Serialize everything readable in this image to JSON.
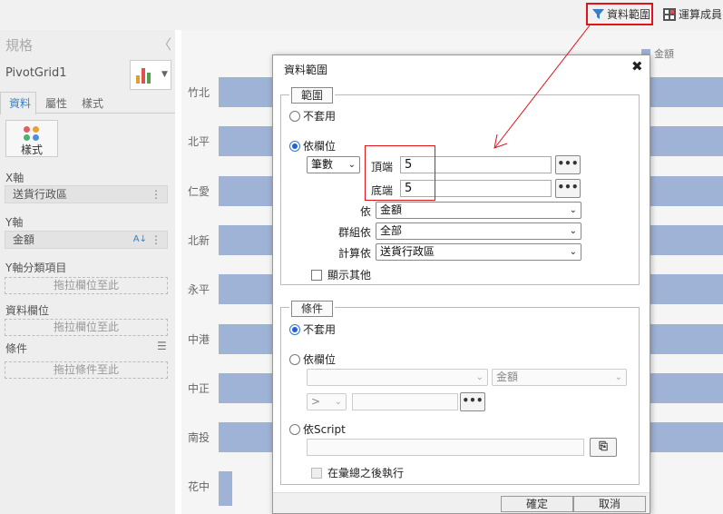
{
  "toolbar": {
    "data_range_label": "資料範圍",
    "calc_member_label": "運算成員"
  },
  "left_panel": {
    "title": "規格",
    "component_name": "PivotGrid1",
    "tabs": [
      "資料",
      "屬性",
      "樣式"
    ],
    "style_button_label": "樣式",
    "x_axis_label": "X軸",
    "x_axis_value": "送貨行政區",
    "y_axis_label": "Y軸",
    "y_axis_value": "金額",
    "y_category_label": "Y軸分類項目",
    "drop_field_text": "拖拉欄位至此",
    "data_field_label": "資料欄位",
    "drop_field_text_2": "拖拉欄位至此",
    "condition_label": "條件",
    "drop_condition_text": "拖拉條件至此"
  },
  "chart_data": {
    "type": "bar",
    "legend": "金額",
    "categories": [
      "竹北",
      "北平",
      "仁愛",
      "北新",
      "永平",
      "中港",
      "中正",
      "南投",
      "花中"
    ],
    "colors": {
      "bar": "#9fb3d6"
    }
  },
  "dialog": {
    "title": "資料範圍",
    "range_section": {
      "legend": "範圍",
      "option_none": "不套用",
      "option_by_field": "依欄位",
      "count_mode": "筆數",
      "top_label": "頂端",
      "top_value": "5",
      "bottom_label": "底端",
      "bottom_value": "5",
      "by_label": "依",
      "by_value": "金額",
      "group_by_label": "群組依",
      "group_by_value": "全部",
      "calc_by_label": "計算依",
      "calc_by_value": "送貨行政區",
      "show_others_label": "顯示其他"
    },
    "condition_section": {
      "legend": "條件",
      "option_none": "不套用",
      "option_by_field": "依欄位",
      "field_value": "",
      "field2_value": "金額",
      "operator": ">",
      "option_script": "依Script",
      "run_after_summary_label": "在彙總之後執行"
    },
    "ok_label": "確定",
    "cancel_label": "取消"
  }
}
